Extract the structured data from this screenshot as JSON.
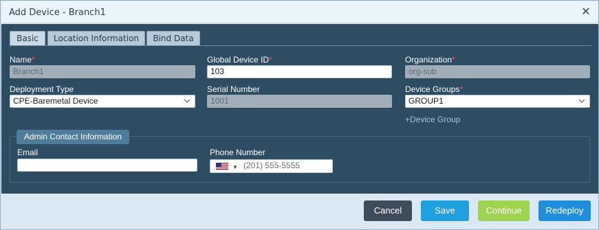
{
  "dialog": {
    "title": "Add Device - Branch1",
    "close_icon": "close-icon"
  },
  "tabs": [
    {
      "label": "Basic",
      "active": true
    },
    {
      "label": "Location Information",
      "active": false
    },
    {
      "label": "Bind Data",
      "active": false
    }
  ],
  "form": {
    "name": {
      "label": "Name",
      "required": "*",
      "value": "Branch1"
    },
    "global_device_id": {
      "label": "Global Device ID",
      "required": "*",
      "value": "103"
    },
    "organization": {
      "label": "Organization",
      "required": "*",
      "value": "org-sub"
    },
    "deployment_type": {
      "label": "Deployment Type",
      "value": "CPE-Baremetal Device"
    },
    "serial_number": {
      "label": "Serial Number",
      "value": "1001"
    },
    "device_groups": {
      "label": "Device Groups",
      "required": "*",
      "value": "GROUP1"
    },
    "add_device_group": "+Device Group"
  },
  "admin_contact": {
    "legend": "Admin Contact Information",
    "email": {
      "label": "Email",
      "value": ""
    },
    "phone": {
      "label": "Phone Number",
      "placeholder": "(201) 555-5555",
      "flag_icon": "us-flag-icon"
    }
  },
  "footer": {
    "cancel": "Cancel",
    "save": "Save",
    "continue": "Continue",
    "redeploy": "Redeploy"
  },
  "colors": {
    "cancel": "#3e4b5a",
    "save": "#1ea1de",
    "continue": "#9fd44f",
    "redeploy": "#1e8fdc"
  }
}
